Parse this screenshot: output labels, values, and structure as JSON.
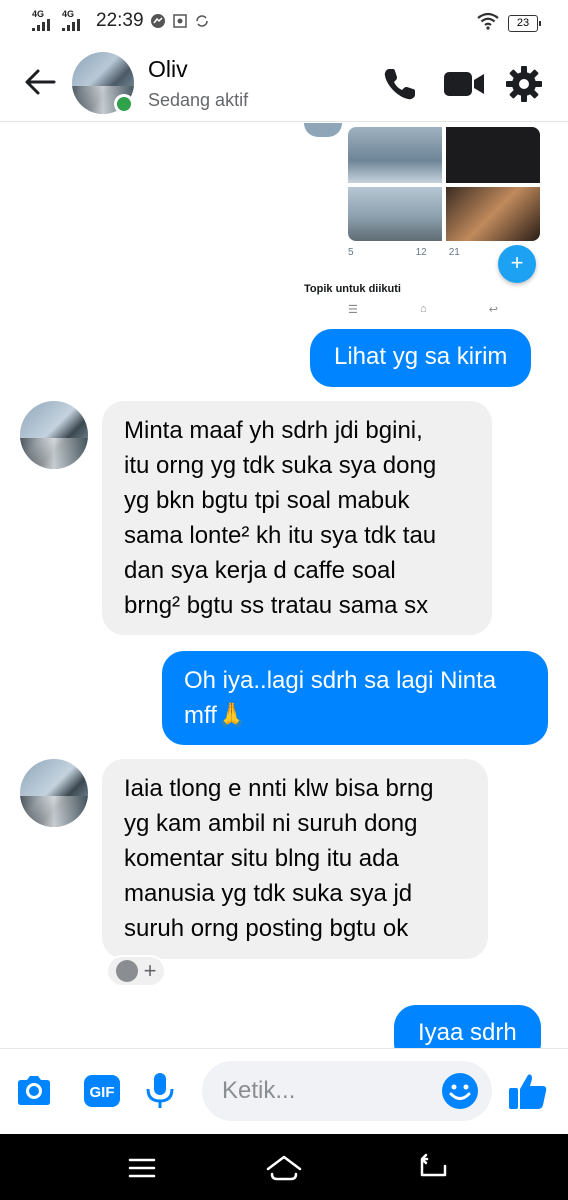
{
  "status_bar": {
    "network1": "4G",
    "network2": "4G",
    "time": "22:39",
    "battery": "23"
  },
  "header": {
    "contact_name": "Oliv",
    "contact_status": "Sedang aktif"
  },
  "shared_image": {
    "actions": [
      "5",
      "12",
      "21"
    ],
    "topic_label": "Topik untuk diikuti"
  },
  "messages": [
    {
      "side": "out",
      "text": "Lihat yg sa kirim"
    },
    {
      "side": "in",
      "lines": [
        "Minta maaf yh sdrh jdi bgini,",
        "itu orng yg tdk suka sya dong",
        "yg bkn bgtu tpi soal mabuk",
        "sama lonte² kh itu sya tdk tau",
        "dan sya kerja d caffe soal",
        "brng² bgtu ss tratau sama sx"
      ]
    },
    {
      "side": "out",
      "lines": [
        "Oh iya..lagi sdrh sa lagi Ninta",
        "mff🙏"
      ]
    },
    {
      "side": "in",
      "lines": [
        "Iaia tlong e nnti klw bisa brng",
        "yg kam ambil ni suruh dong",
        "komentar situ blng itu ada",
        "manusia yg tdk suka sya jd",
        "suruh orng posting bgtu ok"
      ]
    },
    {
      "side": "out",
      "text": "Iyaa sdrh"
    }
  ],
  "composer": {
    "placeholder": "Ketik..."
  },
  "colors": {
    "accent": "#0084ff",
    "incoming_bubble": "#f0f0f0",
    "online": "#31a24c"
  },
  "icons": [
    "back-arrow-icon",
    "phone-icon",
    "video-call-icon",
    "settings-gear-icon",
    "camera-icon",
    "gif-icon",
    "microphone-icon",
    "emoji-icon",
    "thumbs-up-icon",
    "menu-icon",
    "home-icon",
    "back-icon"
  ]
}
